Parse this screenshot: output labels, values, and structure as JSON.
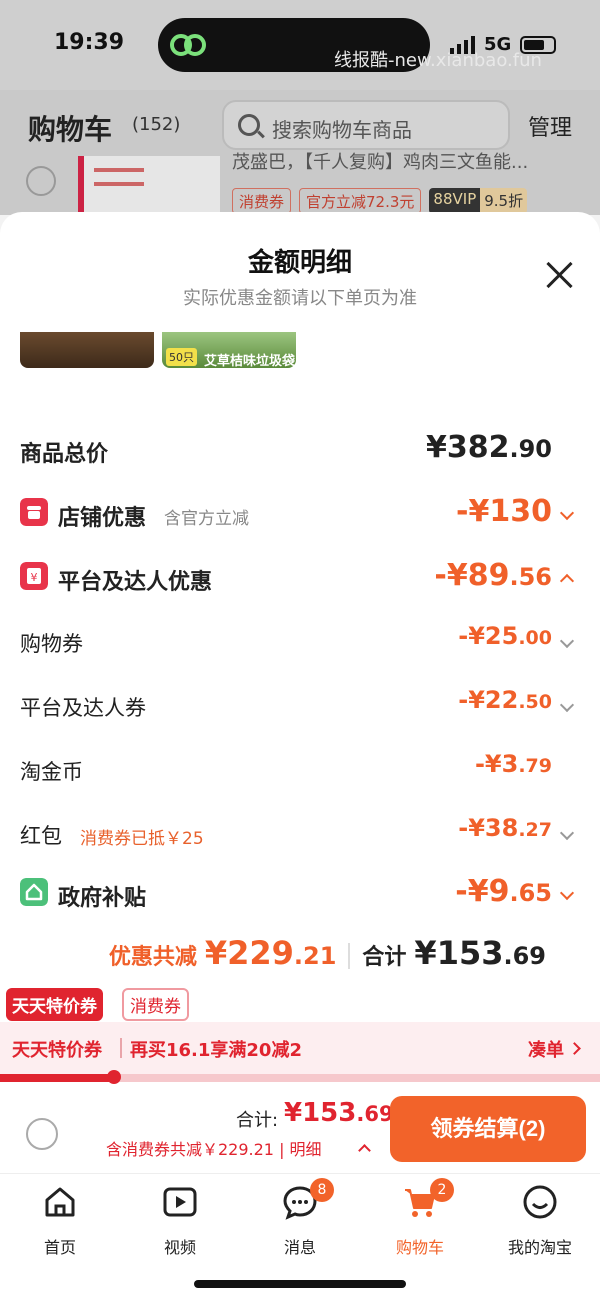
{
  "status_bar": {
    "time": "19:39",
    "network": "5G",
    "watermark": "线报酷-new.xianbao.fun"
  },
  "cart_header": {
    "title": "购物车",
    "count": "(152)",
    "search_placeholder": "搜索购物车商品",
    "manage": "管理",
    "item_title": "茂盛巴，【千人复购】鸡肉三文鱼能...",
    "tags": [
      "消费券",
      "官方立减72.3元"
    ],
    "vip_tag": "88VIP",
    "vip_discount": "9.5折"
  },
  "sheet": {
    "title": "金额明细",
    "subtitle": "实际优惠金额请以下单页为准",
    "product_image_label": "50只",
    "product_image_text": "艾草桔味垃圾袋"
  },
  "rows": {
    "total": {
      "label": "商品总价",
      "value_main": "¥382",
      "value_dec": ".90"
    },
    "store": {
      "label": "店铺优惠",
      "note": "含官方立减",
      "value_main": "-¥130",
      "value_dec": ""
    },
    "platform": {
      "label": "平台及达人优惠",
      "value_main": "-¥89",
      "value_dec": ".56"
    },
    "shopping_coupon": {
      "label": "购物券",
      "value_main": "-¥25",
      "value_dec": ".00"
    },
    "creator_coupon": {
      "label": "平台及达人券",
      "value_main": "-¥22",
      "value_dec": ".50"
    },
    "taojinbi": {
      "label": "淘金币",
      "value_main": "-¥3",
      "value_dec": ".79"
    },
    "redpacket": {
      "label": "红包",
      "note": "消费券已抵￥25",
      "value_main": "-¥38",
      "value_dec": ".27"
    },
    "gov": {
      "label": "政府补贴",
      "value_main": "-¥9",
      "value_dec": ".65"
    }
  },
  "summary": {
    "discount_label": "优惠共减",
    "discount_main": "¥229",
    "discount_dec": ".21",
    "total_label": "合计",
    "total_main": "¥153",
    "total_dec": ".69"
  },
  "promo": {
    "tag1": "天天特价券",
    "tag2": "消费券",
    "bar_title": "天天特价券",
    "bar_text": "再买16.1享满20减2",
    "bar_action": "凑单",
    "progress": 0.19
  },
  "checkout": {
    "total_label": "合计:",
    "total_main": "¥153",
    "total_dec": ".69",
    "note": "含消费券共减￥229.21 | 明细",
    "button": "领券结算(2)"
  },
  "tabbar": {
    "home": "首页",
    "video": "视频",
    "messages": "消息",
    "messages_badge": "8",
    "cart": "购物车",
    "cart_badge": "2",
    "me": "我的淘宝"
  },
  "colors": {
    "accent": "#f0602a",
    "red": "#e0242f"
  }
}
